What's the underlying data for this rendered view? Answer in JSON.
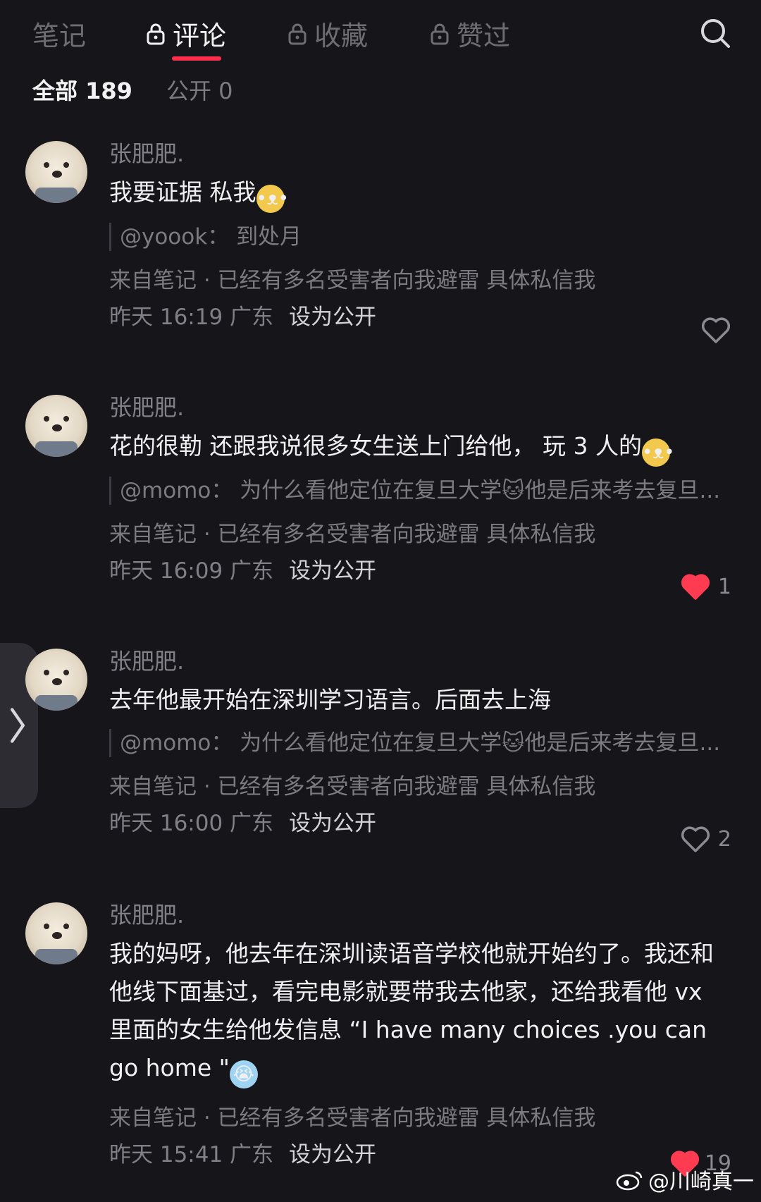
{
  "tabs": [
    {
      "label": "笔记",
      "locked": false
    },
    {
      "label": "评论",
      "locked": true,
      "active": true
    },
    {
      "label": "收藏",
      "locked": true
    },
    {
      "label": "赞过",
      "locked": true
    }
  ],
  "filters": {
    "all": "全部 189",
    "public": "公开 0"
  },
  "comments": [
    {
      "author": "张肥肥.",
      "text": "我要证据 私我",
      "quote_user": "@yoook：",
      "quote_text": "到处月",
      "source": "来自笔记 · 已经有多名受害者向我避雷 具体私信我",
      "time": "昨天 16:19 广东",
      "public_btn": "设为公开",
      "likes": "",
      "liked": false
    },
    {
      "author": "张肥肥.",
      "text": "花的很勒 还跟我说很多女生送上门给他， 玩 3 人的",
      "quote_user": "@momo：",
      "quote_text": "为什么看他定位在复旦大学🐱他是后来考去复旦...",
      "source": "来自笔记 · 已经有多名受害者向我避雷 具体私信我",
      "time": "昨天 16:09 广东",
      "public_btn": "设为公开",
      "likes": "1",
      "liked": true
    },
    {
      "author": "张肥肥.",
      "text": "去年他最开始在深圳学习语言。后面去上海",
      "quote_user": "@momo：",
      "quote_text": "为什么看他定位在复旦大学🐱他是后来考去复旦...",
      "source": "来自笔记 · 已经有多名受害者向我避雷 具体私信我",
      "time": "昨天 16:00 广东",
      "public_btn": "设为公开",
      "likes": "2",
      "liked": false
    },
    {
      "author": "张肥肥.",
      "text": "我的妈呀，他去年在深圳读语音学校他就开始约了。我还和他线下面基过，看完电影就要带我去他家，还给我看他 vx 里面的女生给他发信息 “I have many choices .you can go home \"",
      "source": "来自笔记 · 已经有多名受害者向我避雷 具体私信我",
      "time": "昨天 15:41 广东",
      "public_btn": "设为公开",
      "likes": "19",
      "liked": true
    }
  ],
  "watermark": "@川崎真一",
  "colors": {
    "accent": "#ff2e4d",
    "background": "#15151a",
    "heart_liked": "#ff3b52"
  }
}
